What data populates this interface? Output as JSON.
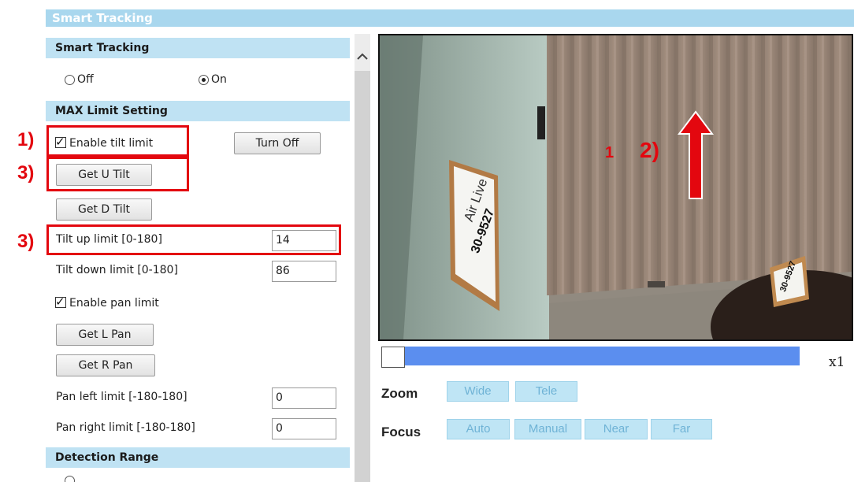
{
  "page": {
    "title": "Smart Tracking"
  },
  "smart_tracking": {
    "header": "Smart Tracking",
    "options": [
      {
        "label": "Off",
        "selected": false
      },
      {
        "label": "On",
        "selected": true
      }
    ]
  },
  "max_limit": {
    "header": "MAX Limit Setting",
    "enable_tilt_limit": {
      "label": "Enable tilt limit",
      "checked": true
    },
    "turn_off_button": "Turn Off",
    "get_u_tilt_button": "Get U Tilt",
    "get_d_tilt_button": "Get D Tilt",
    "tilt_up_limit": {
      "label": "Tilt up limit [0-180]",
      "value": "14"
    },
    "tilt_down_limit": {
      "label": "Tilt down limit [0-180]",
      "value": "86"
    },
    "enable_pan_limit": {
      "label": "Enable pan limit",
      "checked": true
    },
    "get_l_pan_button": "Get L Pan",
    "get_r_pan_button": "Get R Pan",
    "pan_left_limit": {
      "label": "Pan left limit [-180-180]",
      "value": "0"
    },
    "pan_right_limit": {
      "label": "Pan right limit [-180-180]",
      "value": "0"
    }
  },
  "detection_range": {
    "header": "Detection Range"
  },
  "annotations": {
    "step1": "1)",
    "step2": "2)",
    "step3a": "3)",
    "step3b": "3)",
    "marker": "1"
  },
  "video": {
    "sign_text_top": "Air Live",
    "sign_text_bottom": "30-9527",
    "desk_sign_text": "30-9527"
  },
  "zoom_slider": {
    "value_text": "x1",
    "level": 0.0
  },
  "zoom": {
    "label": "Zoom",
    "buttons": [
      "Wide",
      "Tele"
    ]
  },
  "focus": {
    "label": "Focus",
    "buttons": [
      "Auto",
      "Manual",
      "Near",
      "Far"
    ]
  },
  "colors": {
    "annotation_red": "#e3070f",
    "header_blue": "#a9d7ee",
    "section_blue": "#bfe2f3",
    "slider_blue": "#5b8eef"
  },
  "icons": {
    "scroll_up": "chevron-up-icon",
    "arrow": "arrow-up-icon"
  }
}
